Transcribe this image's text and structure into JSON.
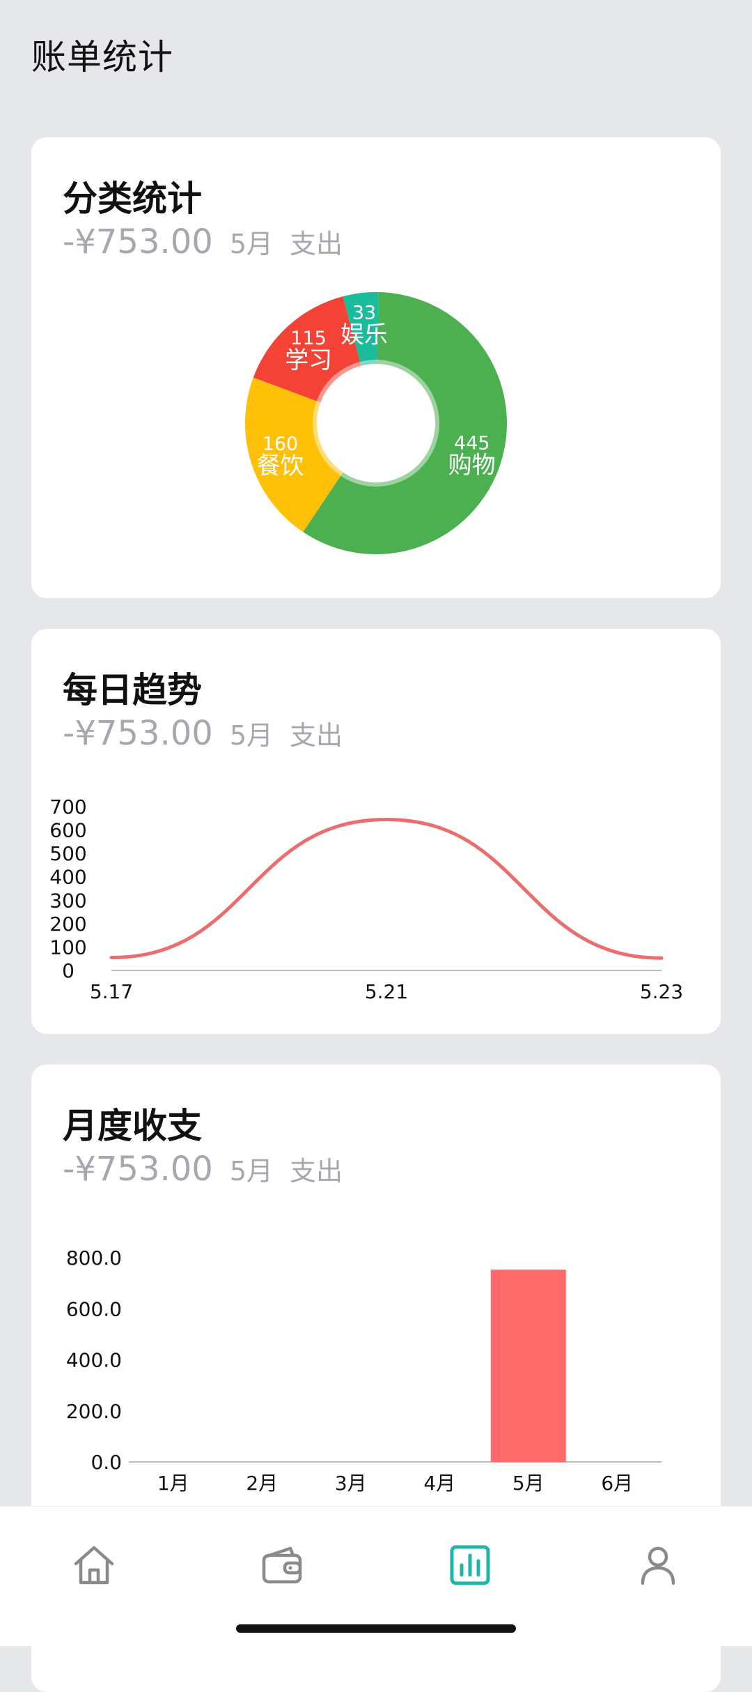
{
  "page": {
    "title": "账单统计"
  },
  "colors": {
    "background": "#E6E7EB",
    "card": "#FFFFFF",
    "muted_text": "#A5A8AE",
    "line": "#EB6E6E",
    "bar": "#FF6B6B",
    "tab_active": "#1FB5A8",
    "tab_inactive": "#8A8A8A"
  },
  "cards": {
    "category": {
      "title": "分类统计",
      "amount": "-¥753.00",
      "month": "5月",
      "kind": "支出"
    },
    "daily": {
      "title": "每日趋势",
      "amount": "-¥753.00",
      "month": "5月",
      "kind": "支出"
    },
    "monthly": {
      "title": "月度收支",
      "amount": "-¥753.00",
      "month": "5月",
      "kind": "支出"
    }
  },
  "chart_data": [
    {
      "type": "pie",
      "variant": "donut",
      "slices": [
        {
          "label": "购物",
          "value": 445,
          "value_label": "445",
          "color": "#4CAF50"
        },
        {
          "label": "餐饮",
          "value": 160,
          "value_label": "160",
          "color": "#FFC107"
        },
        {
          "label": "学习",
          "value": 115,
          "value_label": "115",
          "color": "#F44336"
        },
        {
          "label": "娱乐",
          "value": 33,
          "value_label": "33",
          "color": "#1ABC9C"
        }
      ],
      "title": "",
      "legend": "none"
    },
    {
      "type": "line",
      "smooth": true,
      "x": [
        "5.17",
        "5.21",
        "5.23"
      ],
      "y": [
        55,
        645,
        53
      ],
      "xticks": [
        "5.17",
        "5.21",
        "5.23"
      ],
      "yticks": [
        "0",
        "100",
        "200",
        "300",
        "400",
        "500",
        "600",
        "700"
      ],
      "ylim": [
        0,
        700
      ],
      "xlabel": "",
      "ylabel": "",
      "grid": false,
      "legend": "none"
    },
    {
      "type": "bar",
      "categories": [
        "1月",
        "2月",
        "3月",
        "4月",
        "5月",
        "6月"
      ],
      "values": [
        0,
        0,
        0,
        0,
        753,
        0
      ],
      "yticks": [
        "0.0",
        "200.0",
        "400.0",
        "600.0",
        "800.0"
      ],
      "ylim": [
        0,
        800
      ],
      "xlabel": "",
      "ylabel": "",
      "grid": false,
      "legend": "none"
    }
  ],
  "tabbar": {
    "active": "stats",
    "items": [
      {
        "key": "home",
        "icon": "home-icon"
      },
      {
        "key": "wallet",
        "icon": "wallet-icon"
      },
      {
        "key": "stats",
        "icon": "bar-chart-icon"
      },
      {
        "key": "profile",
        "icon": "user-icon"
      }
    ]
  }
}
